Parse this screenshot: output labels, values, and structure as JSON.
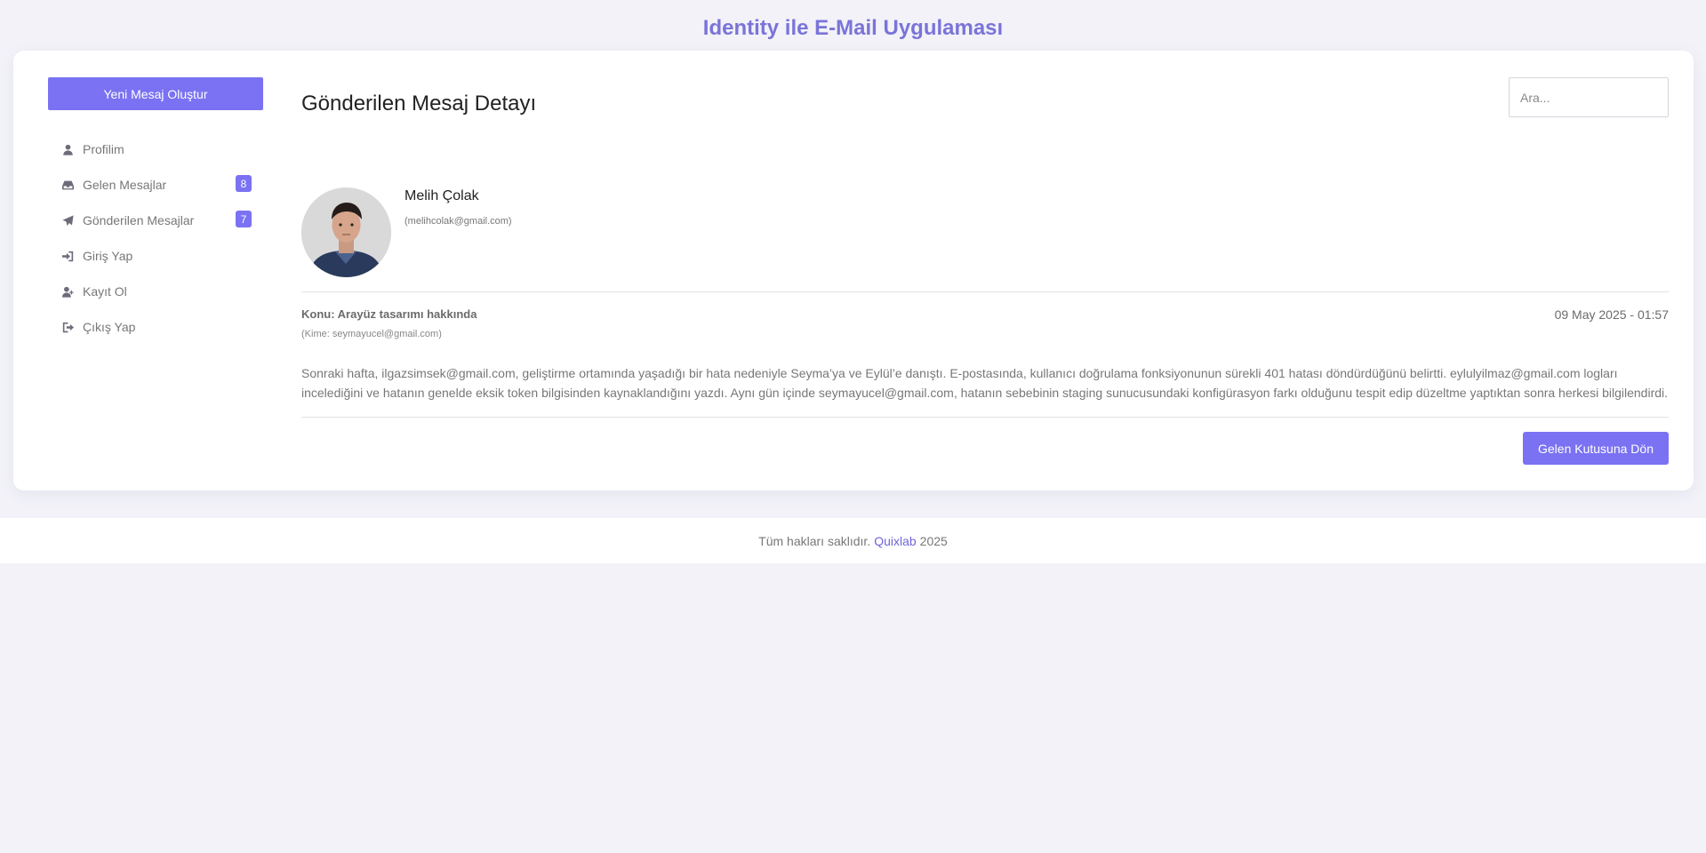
{
  "app": {
    "title": "Identity ile E-Mail Uygulaması"
  },
  "sidebar": {
    "compose_label": "Yeni Mesaj Oluştur",
    "items": [
      {
        "label": "Profilim",
        "icon": "user-icon"
      },
      {
        "label": "Gelen Mesajlar",
        "icon": "inbox-icon",
        "badge": "8"
      },
      {
        "label": "Gönderilen Mesajlar",
        "icon": "paper-plane-icon",
        "badge": "7"
      },
      {
        "label": "Giriş Yap",
        "icon": "sign-in-icon"
      },
      {
        "label": "Kayıt Ol",
        "icon": "user-plus-icon"
      },
      {
        "label": "Çıkış Yap",
        "icon": "sign-out-icon"
      }
    ]
  },
  "main": {
    "title": "Gönderilen Mesaj Detayı",
    "search_placeholder": "Ara...",
    "sender": {
      "name": "Melih Çolak",
      "email": "(melihcolak@gmail.com)"
    },
    "subject": "Konu: Arayüz tasarımı hakkında",
    "recipient": "(Kime: seymayucel@gmail.com)",
    "date": "09 May 2025 - 01:57",
    "body": "Sonraki hafta, ilgazsimsek@gmail.com, geliştirme ortamında yaşadığı bir hata nedeniyle Seyma’ya ve Eylül’e danıştı. E-postasında, kullanıcı doğrulama fonksiyonunun sürekli 401 hatası döndürdüğünü belirtti. eylulyilmaz@gmail.com logları incelediğini ve hatanın genelde eksik token bilgisinden kaynaklandığını yazdı. Aynı gün içinde seymayucel@gmail.com, hatanın sebebinin staging sunucusundaki konfigürasyon farkı olduğunu tespit edip düzeltme yaptıktan sonra herkesi bilgilendirdi.",
    "back_label": "Gelen Kutusuna Dön"
  },
  "footer": {
    "prefix": "Tüm hakları saklıdır.",
    "brand": "Quixlab",
    "year": "2025"
  },
  "colors": {
    "accent": "#7a72f2",
    "title": "#7a74d8",
    "background": "#f2f2f8"
  }
}
